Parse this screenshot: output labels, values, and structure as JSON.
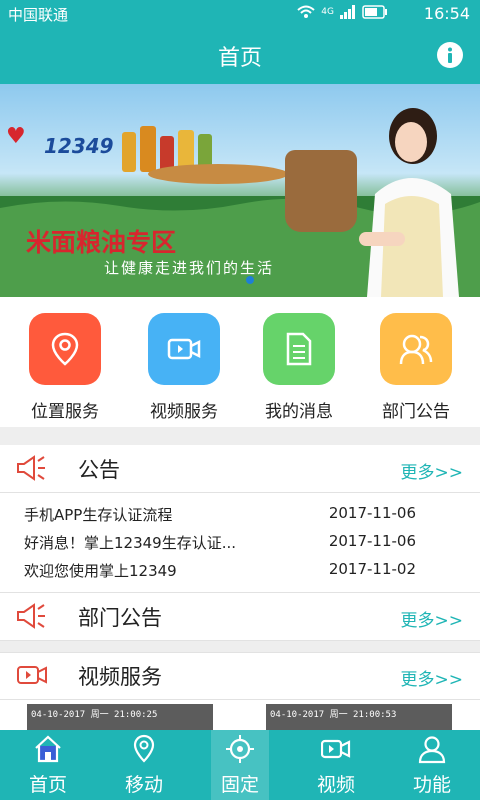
{
  "status": {
    "carrier": "中国联通",
    "network": "4G",
    "time": "16:54"
  },
  "header": {
    "title": "首页",
    "info_icon": "info-icon"
  },
  "banner": {
    "brand": "12349",
    "heading": "米面粮油专区",
    "slogan": "让健康走进我们的生活",
    "pages": 1,
    "current_page": 1
  },
  "services": [
    {
      "label": "位置服务",
      "icon": "location-pin-icon",
      "color": "#ff5a3c"
    },
    {
      "label": "视频服务",
      "icon": "video-camera-icon",
      "color": "#47b2f5"
    },
    {
      "label": "我的消息",
      "icon": "document-icon",
      "color": "#66d36a"
    },
    {
      "label": "部门公告",
      "icon": "group-icon",
      "color": "#ffbd4a"
    }
  ],
  "announcements": {
    "title": "公告",
    "more": "更多>>",
    "items": [
      {
        "title": "手机APP生存认证流程",
        "date": "2017-11-06"
      },
      {
        "title": "好消息！掌上12349生存认证...",
        "date": "2017-11-06"
      },
      {
        "title": "欢迎您使用掌上12349",
        "date": "2017-11-02"
      }
    ]
  },
  "dept_notices": {
    "title": "部门公告",
    "more": "更多>>"
  },
  "video_service": {
    "title": "视频服务",
    "more": "更多>>",
    "thumbs": [
      {
        "caption": "04-10-2017  周一  21:00:25"
      },
      {
        "caption": "04-10-2017  周一  21:00:53"
      }
    ]
  },
  "tabbar": {
    "items": [
      {
        "label": "首页",
        "icon": "home-icon"
      },
      {
        "label": "移动",
        "icon": "location-icon"
      },
      {
        "label": "固定",
        "icon": "crosshair-icon"
      },
      {
        "label": "视频",
        "icon": "video-icon"
      },
      {
        "label": "功能",
        "icon": "user-icon"
      }
    ]
  },
  "colors": {
    "accent": "#1fb5b5",
    "more_link": "#1fb5b5",
    "megaphone": "#e04a3c"
  }
}
